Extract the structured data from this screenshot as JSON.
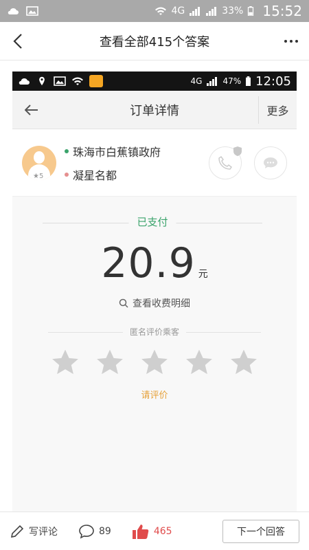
{
  "status_bar": {
    "network": "4G",
    "battery": "33%",
    "time": "15:52"
  },
  "header": {
    "title": "查看全部415个答案"
  },
  "inner_screenshot": {
    "status_bar": {
      "network": "4G",
      "battery": "47%",
      "time": "12:05"
    },
    "header": {
      "title": "订单详情",
      "more_label": "更多"
    },
    "driver": {
      "rating": "5",
      "start": "珠海市白蕉镇政府",
      "end": "凝星名都",
      "start_color": "#3aa36b",
      "end_color": "#e58f8f"
    },
    "payment": {
      "status": "已支付",
      "amount": "20.9",
      "unit": "元",
      "detail_link": "查看收费明细"
    },
    "rating_section": {
      "title": "匿名评价乘客",
      "stars": 5,
      "prompt": "请评价"
    }
  },
  "bottom_bar": {
    "write_comment": "写评论",
    "comment_count": "89",
    "like_count": "465",
    "next_answer": "下一个回答"
  },
  "colors": {
    "accent_green": "#3aa36b",
    "accent_orange": "#e6a23c",
    "like_red": "#e04b4b",
    "star_gray": "#cfcfcf"
  }
}
